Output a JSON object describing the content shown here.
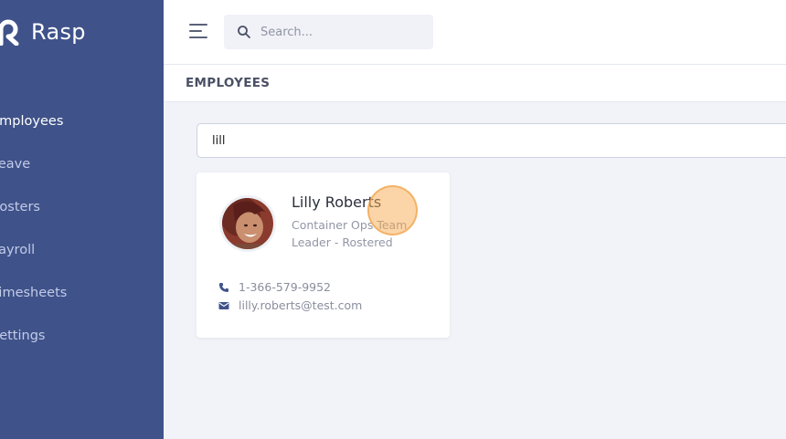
{
  "app": {
    "brand_name": "Rasp",
    "accent_color": "#3f5289"
  },
  "sidebar": {
    "items": [
      {
        "label": "Employees",
        "active": true
      },
      {
        "label": "Leave",
        "active": false
      },
      {
        "label": "Rosters",
        "active": false
      },
      {
        "label": "Payroll",
        "active": false
      },
      {
        "label": "Timesheets",
        "active": false
      },
      {
        "label": "Settings",
        "active": false
      }
    ]
  },
  "topbar": {
    "search_placeholder": "Search..."
  },
  "page": {
    "title": "EMPLOYEES",
    "filter_value": "lill"
  },
  "employee": {
    "name": "Lilly Roberts",
    "role": "Container Ops Team Leader - Rostered",
    "phone": "1-366-579-9952",
    "email": "lilly.roberts@test.com"
  },
  "icons": {
    "brand": "rasp-logo-icon",
    "menu": "hamburger-menu-icon",
    "search": "search-icon",
    "phone": "phone-icon",
    "email": "envelope-icon"
  }
}
